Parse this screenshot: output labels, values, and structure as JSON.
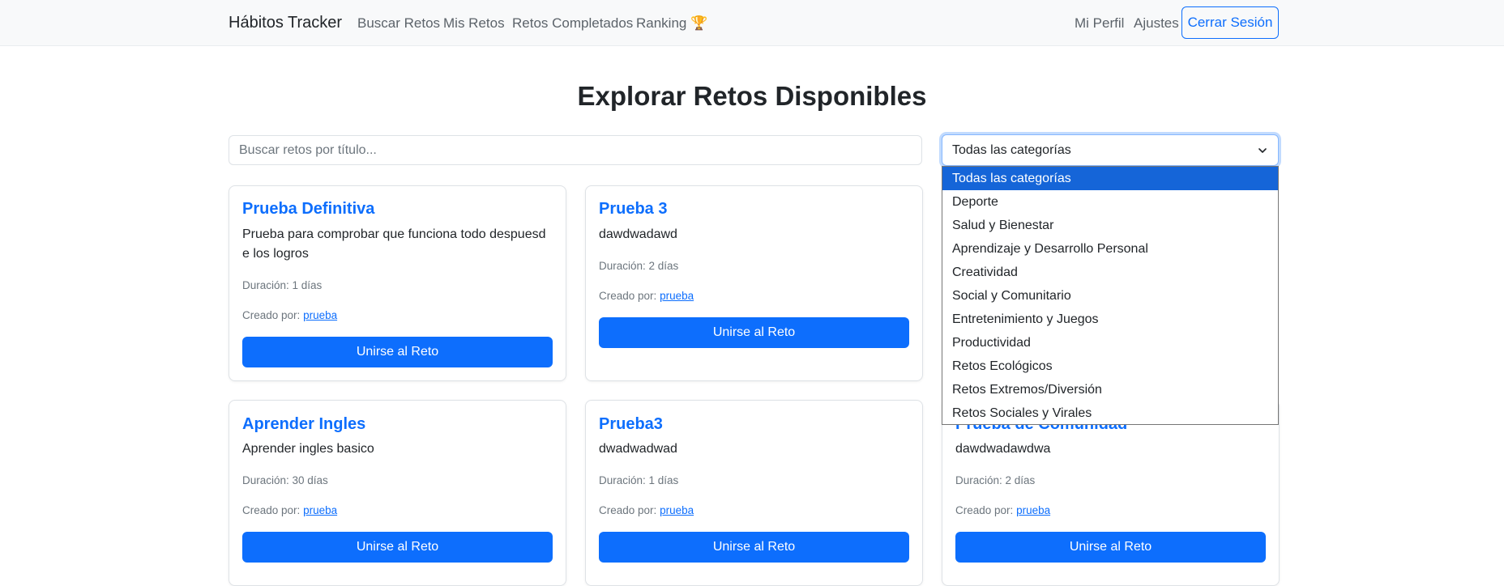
{
  "nav": {
    "brand": "Hábitos Tracker",
    "links": [
      "Buscar Retos",
      "Mis Retos",
      "Retos Completados",
      "Ranking 🏆"
    ],
    "profile": "Mi Perfil",
    "settings": "Ajustes",
    "logout": "Cerrar Sesión"
  },
  "page": {
    "title": "Explorar Retos Disponibles"
  },
  "search": {
    "placeholder": "Buscar retos por título..."
  },
  "category_select": {
    "value": "Todas las categorías",
    "options": [
      "Todas las categorías",
      "Deporte",
      "Salud y Bienestar",
      "Aprendizaje y Desarrollo Personal",
      "Creatividad",
      "Social y Comunitario",
      "Entretenimiento y Juegos",
      "Productividad",
      "Retos Ecológicos",
      "Retos Extremos/Diversión",
      "Retos Sociales y Virales"
    ],
    "selected_index": 0
  },
  "created_by_label": "Creado por:",
  "cards": [
    {
      "title": "Prueba Definitiva",
      "description": "Prueba para comprobar que funciona todo despuesd e los logros",
      "duration": "Duración: 1 días",
      "creator": "prueba",
      "button": "Unirse al Reto"
    },
    {
      "title": "Prueba 3",
      "description": "dawdwadawd",
      "duration": "Duración: 2 días",
      "creator": "prueba",
      "button": "Unirse al Reto"
    },
    {
      "title": "Aprender Ingles",
      "description": "Aprender ingles basico",
      "duration": "Duración: 30 días",
      "creator": "prueba",
      "button": "Unirse al Reto"
    },
    {
      "title": "Prueba3",
      "description": "dwadwadwad",
      "duration": "Duración: 1 días",
      "creator": "prueba",
      "button": "Unirse al Reto"
    },
    {
      "title": "Prueba de Comunidad",
      "description": "dawdwadawdwa",
      "duration": "Duración: 2 días",
      "creator": "prueba",
      "button": "Unirse al Reto"
    }
  ],
  "colors": {
    "primary": "#0d6efd",
    "navbar_bg": "#f8f9fa",
    "option_highlight": "#1565d8"
  }
}
